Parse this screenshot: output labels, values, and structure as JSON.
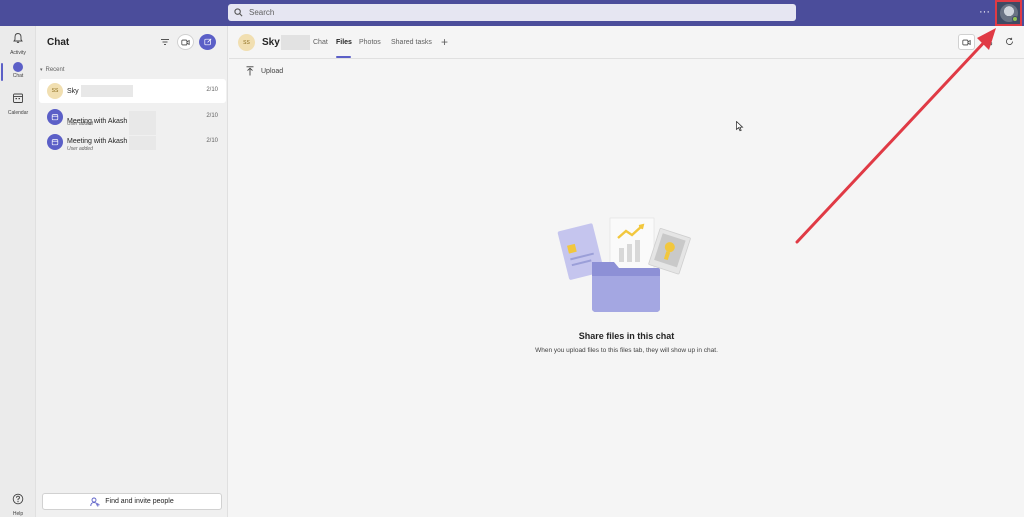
{
  "topbar": {
    "search_placeholder": "Search",
    "more_label": "···"
  },
  "rail": {
    "items": [
      {
        "label": "Activity",
        "icon": "bell-icon"
      },
      {
        "label": "Chat",
        "icon": "chat-icon"
      },
      {
        "label": "Calendar",
        "icon": "calendar-icon"
      },
      {
        "label": "Help",
        "icon": "help-icon"
      }
    ]
  },
  "chat_panel": {
    "title": "Chat",
    "section_label": "Recent",
    "items": [
      {
        "name": "Sky",
        "initials": "SS",
        "date": "2/10",
        "subtitle": ""
      },
      {
        "name": "Meeting with Akash",
        "initials": "",
        "date": "2/10",
        "subtitle": "User added"
      },
      {
        "name": "Meeting with Akash",
        "initials": "",
        "date": "2/10",
        "subtitle": "User added"
      }
    ],
    "find_button": "Find and invite people"
  },
  "main": {
    "initials": "SS",
    "name": "Sky",
    "tabs": [
      {
        "label": "Chat",
        "active": false
      },
      {
        "label": "Files",
        "active": true
      },
      {
        "label": "Photos",
        "active": false
      },
      {
        "label": "Shared tasks",
        "active": false
      }
    ],
    "add_tab": "+",
    "upload_label": "Upload",
    "empty_title": "Share files in this chat",
    "empty_subtitle": "When you upload files to this files tab, they will show up in chat."
  },
  "colors": {
    "topbar": "#4b4d9b",
    "accent": "#5b5fc7",
    "annotation": "#e03a45"
  }
}
